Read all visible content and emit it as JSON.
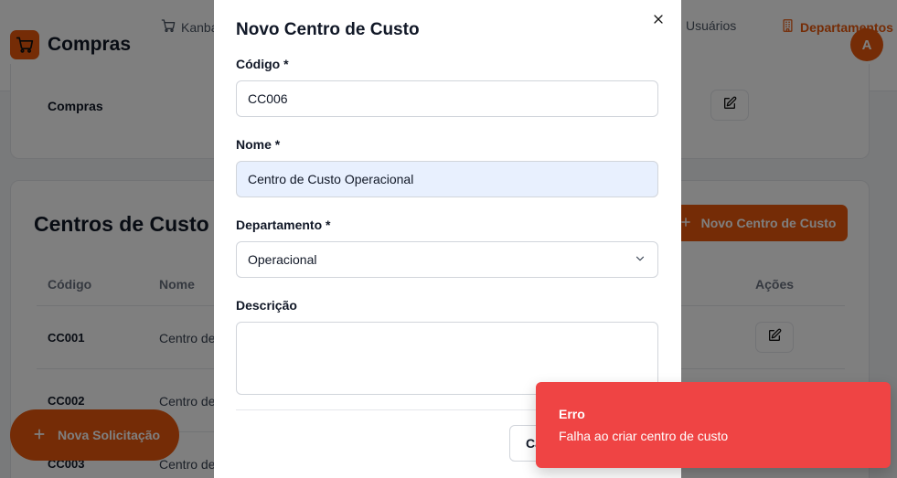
{
  "app": {
    "name": "Compras",
    "nav": [
      {
        "label": "Kanban"
      },
      {
        "label": "Usuários"
      },
      {
        "label": "Departamentos"
      }
    ],
    "avatar_initial": "A",
    "accent_color": "#ea580c"
  },
  "departments": {
    "row_name": "Compras"
  },
  "cost_centers": {
    "title": "Centros de Custo",
    "new_button": "Novo Centro de Custo",
    "columns": {
      "code": "Código",
      "name": "Nome",
      "actions": "Ações"
    },
    "rows": [
      {
        "code": "CC001",
        "name": "Centro de"
      },
      {
        "code": "CC002",
        "name": "Centro de"
      },
      {
        "code": "CC003",
        "name": "Centro de"
      }
    ]
  },
  "fab": {
    "label": "Nova Solicitação"
  },
  "modal": {
    "title": "Novo Centro de Custo",
    "fields": {
      "code": {
        "label": "Código *",
        "value": "CC006"
      },
      "name": {
        "label": "Nome *",
        "value": "Centro de Custo Operacional"
      },
      "department": {
        "label": "Departamento *",
        "value": "Operacional"
      },
      "description": {
        "label": "Descrição",
        "value": ""
      }
    },
    "cancel_button": "Cancelar"
  },
  "toast": {
    "title": "Erro",
    "message": "Falha ao criar centro de custo",
    "color": "#ef4444"
  }
}
